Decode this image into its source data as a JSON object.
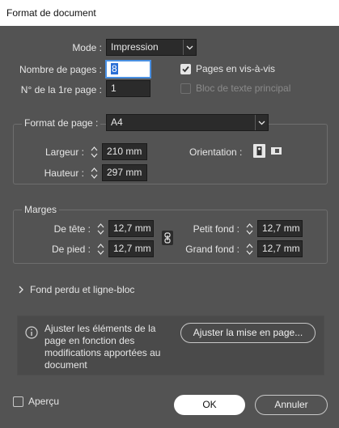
{
  "window": {
    "title": "Format de document"
  },
  "mode": {
    "label": "Mode :",
    "value": "Impression"
  },
  "pages": {
    "count_label": "Nombre de pages :",
    "count_value": "8",
    "first_label": "N° de la 1re page :",
    "first_value": "1"
  },
  "options": {
    "facing_label": "Pages en vis-à-vis",
    "primary_frame_label": "Bloc de texte principal"
  },
  "page_size": {
    "label": "Format de page :",
    "value": "A4",
    "width_label": "Largeur :",
    "width_value": "210 mm",
    "height_label": "Hauteur :",
    "height_value": "297 mm",
    "orientation_label": "Orientation :"
  },
  "margins": {
    "title": "Marges",
    "top_label": "De tête :",
    "top_value": "12,7 mm",
    "bottom_label": "De pied :",
    "bottom_value": "12,7 mm",
    "inside_label": "Petit fond :",
    "inside_value": "12,7 mm",
    "outside_label": "Grand fond :",
    "outside_value": "12,7 mm"
  },
  "bleed": {
    "label": "Fond perdu et ligne-bloc"
  },
  "info": {
    "text_lines": [
      "Ajuster les éléments de la",
      "page en fonction des",
      "modifications apportées au",
      "document"
    ],
    "adjust_button": "Ajuster la mise en page..."
  },
  "footer": {
    "preview_label": "Aperçu",
    "ok_label": "OK",
    "cancel_label": "Annuler"
  }
}
